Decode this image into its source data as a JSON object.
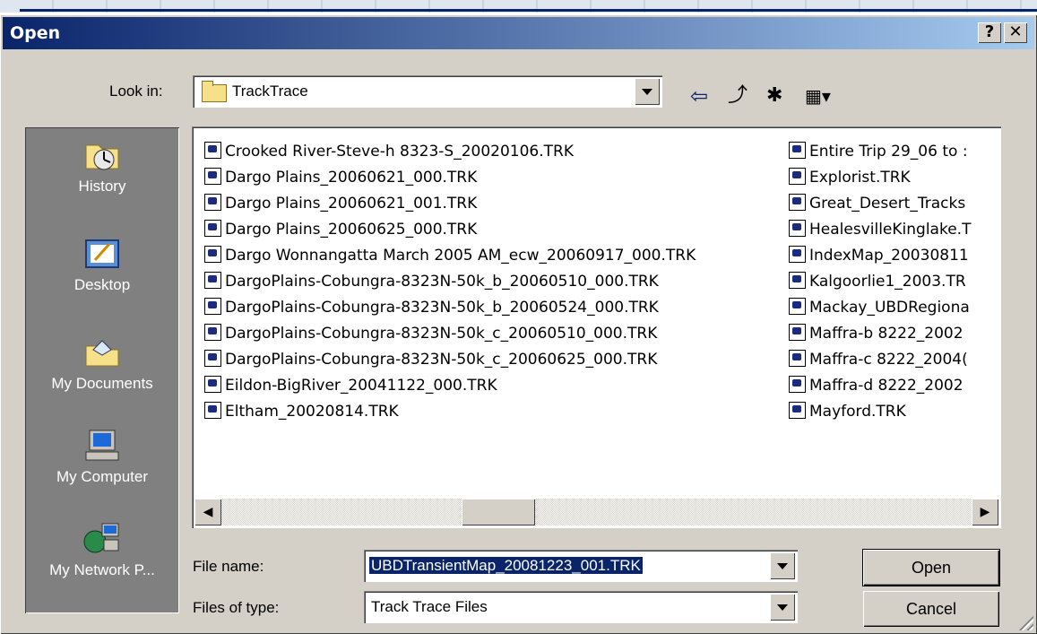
{
  "dialog": {
    "title": "Open",
    "help_label": "?",
    "close_label": "✕"
  },
  "look_in": {
    "label": "Look in:",
    "value": "TrackTrace"
  },
  "toolbar": {
    "back_icon": "back-arrow-icon",
    "up_icon": "up-folder-icon",
    "new_folder_icon": "new-folder-icon",
    "view_icon": "view-menu-icon"
  },
  "places": [
    {
      "label": "History",
      "icon": "history-icon"
    },
    {
      "label": "Desktop",
      "icon": "desktop-icon"
    },
    {
      "label": "My Documents",
      "icon": "my-documents-icon"
    },
    {
      "label": "My Computer",
      "icon": "my-computer-icon"
    },
    {
      "label": "My Network P...",
      "icon": "my-network-places-icon"
    }
  ],
  "files_col1": [
    "Crooked River-Steve-h 8323-S_20020106.TRK",
    "Dargo Plains_20060621_000.TRK",
    "Dargo Plains_20060621_001.TRK",
    "Dargo Plains_20060625_000.TRK",
    "Dargo Wonnangatta March 2005 AM_ecw_20060917_000.TRK",
    "DargoPlains-Cobungra-8323N-50k_b_20060510_000.TRK",
    "DargoPlains-Cobungra-8323N-50k_b_20060524_000.TRK",
    "DargoPlains-Cobungra-8323N-50k_c_20060510_000.TRK",
    "DargoPlains-Cobungra-8323N-50k_c_20060625_000.TRK",
    "Eildon-BigRiver_20041122_000.TRK",
    "Eltham_20020814.TRK"
  ],
  "files_col2": [
    "Entire Trip 29_06 to :",
    "Explorist.TRK",
    "Great_Desert_Tracks",
    "HealesvilleKinglake.T",
    "IndexMap_20030811",
    "Kalgoorlie1_2003.TR",
    "Mackay_UBDRegiona",
    "Maffra-b 8222_2002",
    "Maffra-c 8222_2004(",
    "Maffra-d 8222_2002",
    "Mayford.TRK"
  ],
  "file_name": {
    "label": "File name:",
    "value": "UBDTransientMap_20081223_001.TRK"
  },
  "file_type": {
    "label": "Files of type:",
    "value": "Track Trace Files"
  },
  "buttons": {
    "open": "Open",
    "cancel": "Cancel"
  },
  "scroll": {
    "left": "◀",
    "right": "▶"
  }
}
